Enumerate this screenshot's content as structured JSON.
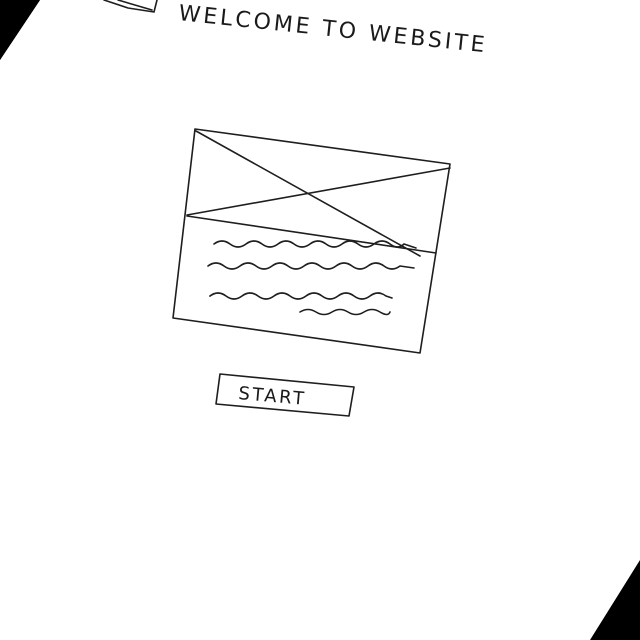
{
  "header": {
    "title": "WELCOME TO WEBSITE"
  },
  "hero": {
    "image_icon": "image-placeholder-icon",
    "text_lines": 3
  },
  "cta": {
    "start_label": "START"
  },
  "colors": {
    "paper": "#ffffff",
    "ink": "#1e1e1e",
    "background": "#000000"
  }
}
